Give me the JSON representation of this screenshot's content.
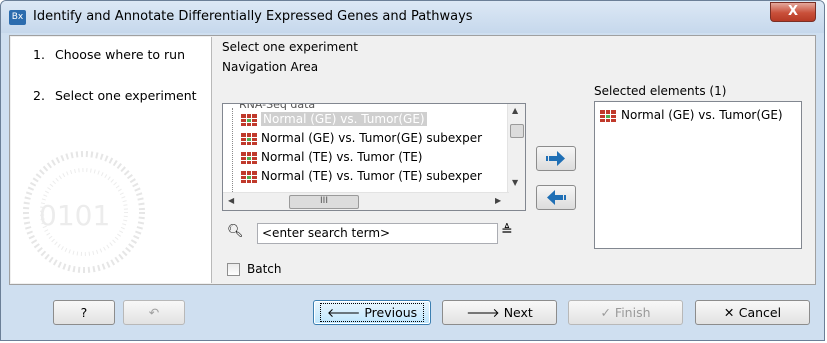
{
  "window": {
    "app_icon_label": "Bx",
    "title": "Identify and Annotate Differentially Expressed Genes and Pathways",
    "close_label": "X"
  },
  "steps": [
    {
      "number": "1.",
      "label": "Choose where to run"
    },
    {
      "number": "2.",
      "label": "Select one experiment"
    }
  ],
  "main": {
    "section_title": "Select one experiment",
    "nav_label": "Navigation Area",
    "tree": {
      "partial_top": "T̶ ̶I̶ ̶R̶N̶A̶ ̶ ̶ ̶d̶a̶t̶a̶",
      "items": [
        {
          "label": "Normal (GE) vs. Tumor(GE)",
          "selected": true
        },
        {
          "label": "Normal (GE) vs. Tumor(GE) subexper",
          "selected": false
        },
        {
          "label": "Normal (TE) vs. Tumor (TE)",
          "selected": false
        },
        {
          "label": "Normal (TE) vs. Tumor (TE) subexper",
          "selected": false
        }
      ],
      "hscroll_thumb_label": "III"
    },
    "search": {
      "placeholder": "<enter search term>"
    },
    "batch_label": "Batch",
    "selected_label": "Selected elements (1)",
    "selected_items": [
      {
        "label": "Normal (GE) vs. Tumor(GE)"
      }
    ]
  },
  "buttons": {
    "help": "?",
    "previous": "Previous",
    "next": "Next",
    "finish": "Finish",
    "cancel": "Cancel"
  },
  "colors": {
    "accent": "#2c6cae",
    "arrow_blue": "#1f6fb5",
    "table_icon_red": "#c0392b",
    "table_icon_green": "#4caf50"
  }
}
